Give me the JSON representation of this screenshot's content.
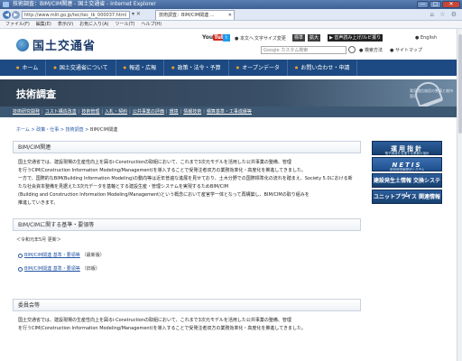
{
  "window": {
    "title": "技術調査：BIM/CIM関連 - 国土交通省 - Internet Explorer",
    "minimize": "—",
    "maximize": "□",
    "close": "✕"
  },
  "browser": {
    "address": "http://www.mlit.go.jp/tec/tec_tk_000037.html",
    "address_tools": "▾ ✕ ",
    "tab_label": "技術調査：BIM/CIM関連 ...",
    "tab_close": "✕",
    "icons": "⌂ ☆ ⚙",
    "menu": [
      "ファイル(F)",
      "編集(E)",
      "表示(V)",
      "お気に入り(A)",
      "ツール(T)",
      "ヘルプ(H)"
    ]
  },
  "site": {
    "logo_text": "国土交通省",
    "youtube_you": "You",
    "youtube_tube": "Tube",
    "twitter": "t",
    "header_links": {
      "english": "● English",
      "honbun": "● 本文へ",
      "text_size": "文字サイズ変更",
      "standard": "標準",
      "large": "拡大",
      "voice": "▶ 音声読み上げ/ルビ振り",
      "search_placeholder": "Google カスタム検索",
      "search_howto": "● 検索方法",
      "sitemap": "● サイトマップ"
    },
    "main_nav": [
      "ホーム",
      "国土交通省について",
      "報道・広報",
      "政策・法令・予算",
      "オープンデータ",
      "お問い合わせ・申請"
    ],
    "banner_title": "技術調査",
    "banner_caption": "電気通信施設の整備と維持管理",
    "sub_nav": [
      "技術研究開発",
      "コスト構造改善",
      "技術管理",
      "入札・契約",
      "公共事業の評価",
      "環境",
      "情報技術",
      "積算基準・工事成績等"
    ],
    "breadcrumb": {
      "home": "ホーム",
      "sep1": " > ",
      "policy": "政策・仕事",
      "sep2": " > ",
      "tech": "技術調査",
      "sep3": " > ",
      "current": "BIM/CIM関連"
    }
  },
  "content": {
    "section1_title": "BIM/CIM関連",
    "para1_lines": [
      "国土交通省では、建設現場の生産性向上を図るi-Constructionの取組において、これまで3次元モデルを活用した公共事業の整備、管理",
      "を行うCIM(Construction Information Modeling/Management)を導入することで受発注者双方の業務効率化・高度化を推進してきました。",
      "一方で、国際的なBIM(Building Information Modeling)の動向等は近年普遍な進展を見せており、土木分野での国際標準化の流れを踏まえ、Society 5.0における新たな社会資本整備を見据えた3次元データを基軸とする建設生産・管理システムを実現するためBIM/CIM",
      "(Building and Construction Information Modeling/Management)という概念において産官学一体となって再構築し、BIM/CIMの取り組みを",
      "推進していきます。"
    ],
    "section2_title": "BIM/CIMに関する基準・要領等",
    "update_note": "＜令和元年5月 更新＞",
    "links": [
      {
        "text": "BIM/CIM関連 基準・要領等",
        "suffix": "（最新版）"
      },
      {
        "text": "BIM/CIM関連 基準・要領等",
        "suffix": "（旧版）"
      }
    ],
    "section3_title": "委員会等",
    "para3_lines": [
      "国土交通省では、建設現場の生産性向上を図るi-Constructionの取組において、これまで3次元モデルを活用した公共事業の整備、管理",
      "を行うCIM(Construction Information Modeling/Management)を導入することで受発注者双方の業務効率化・高度化を推進してきました。"
    ]
  },
  "sidebar": {
    "b1": "運用指針",
    "b1_sub": "電子調達を支援する業務の指針",
    "b2": "NETIS",
    "b2_sub": "新技術情報提供システム",
    "b3": "建設発生土情報 交換システム",
    "b4": "ユニットプライス 関連情報"
  }
}
